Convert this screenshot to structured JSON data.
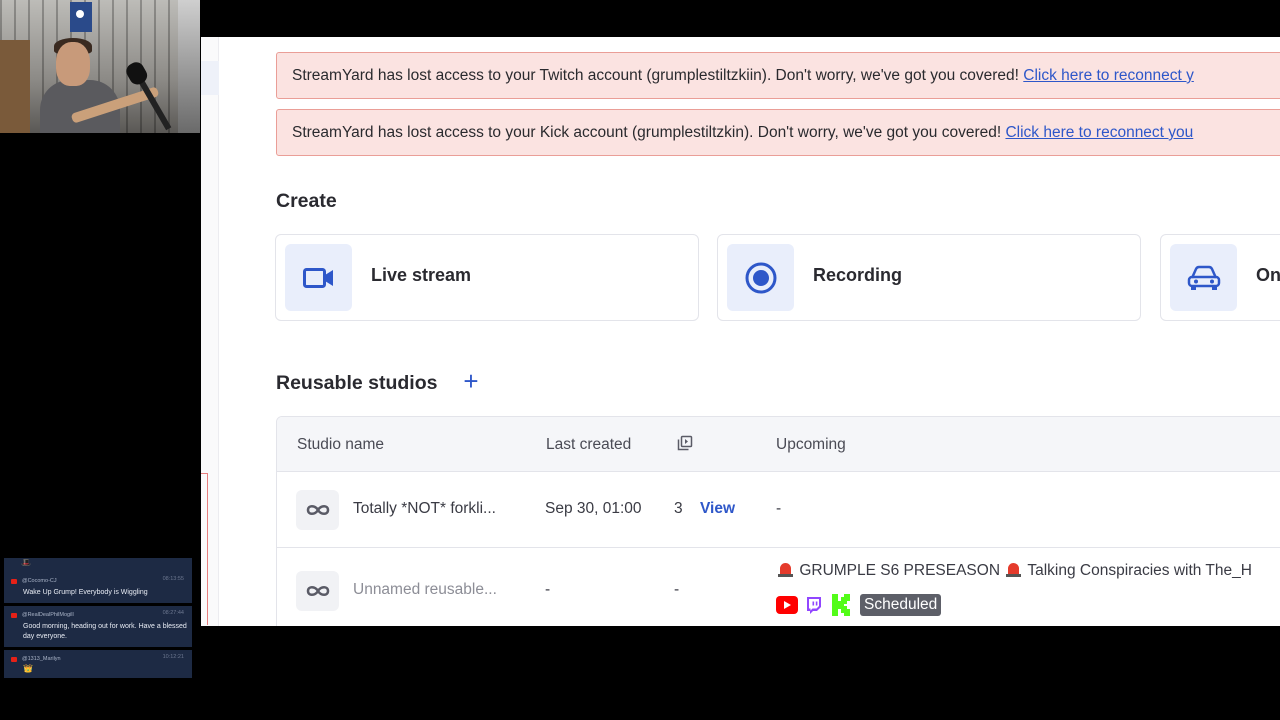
{
  "overlay": {
    "chat": {
      "top_emoji": "🎩",
      "messages": [
        {
          "user": "@Cocomo-CJ",
          "time": "08:13:55",
          "text": "Wake Up Grump! Everybody is Wiggling"
        },
        {
          "user": "@RealDealPhilMogill",
          "time": "08:27:44",
          "text": "Good morning, heading out for work. Have a blessed day everyone."
        },
        {
          "user": "@1313_Marilyn",
          "time": "10:12:21",
          "text": "👑"
        }
      ]
    }
  },
  "alerts": [
    {
      "text": "StreamYard has lost access to your Twitch account (grumplestiltzkiin). Don't worry, we've got you covered! ",
      "link": "Click here to reconnect y"
    },
    {
      "text": "StreamYard has lost access to your Kick account (grumplestiltzkin). Don't worry, we've got you covered! ",
      "link": "Click here to reconnect you"
    }
  ],
  "create": {
    "title": "Create",
    "cards": [
      {
        "label": "Live stream",
        "icon": "video-camera-icon"
      },
      {
        "label": "Recording",
        "icon": "record-icon"
      },
      {
        "label": "On",
        "icon": "car-icon"
      }
    ]
  },
  "reusable": {
    "title": "Reusable studios",
    "add_icon": "+",
    "columns": {
      "name": "Studio name",
      "last": "Last created",
      "copy_icon": "copy-icon",
      "upcoming": "Upcoming"
    },
    "rows": [
      {
        "name": "Totally *NOT* forkli...",
        "last": "Sep 30, 01:00",
        "count": "3",
        "view": "View",
        "upcoming": "-"
      },
      {
        "name": "Unnamed reusable...",
        "last": "-",
        "count": "-",
        "upcoming_pre": "GRUMPLE S6 PRESEASON",
        "upcoming_post": "Talking Conspiracies with The_H",
        "status": "Scheduled"
      }
    ]
  },
  "colors": {
    "accent": "#2e57c9",
    "alert_bg": "#fbe3e1",
    "alert_border": "#ea9e97",
    "youtube": "#ff0000",
    "twitch": "#9146ff",
    "kick": "#53fc18"
  }
}
